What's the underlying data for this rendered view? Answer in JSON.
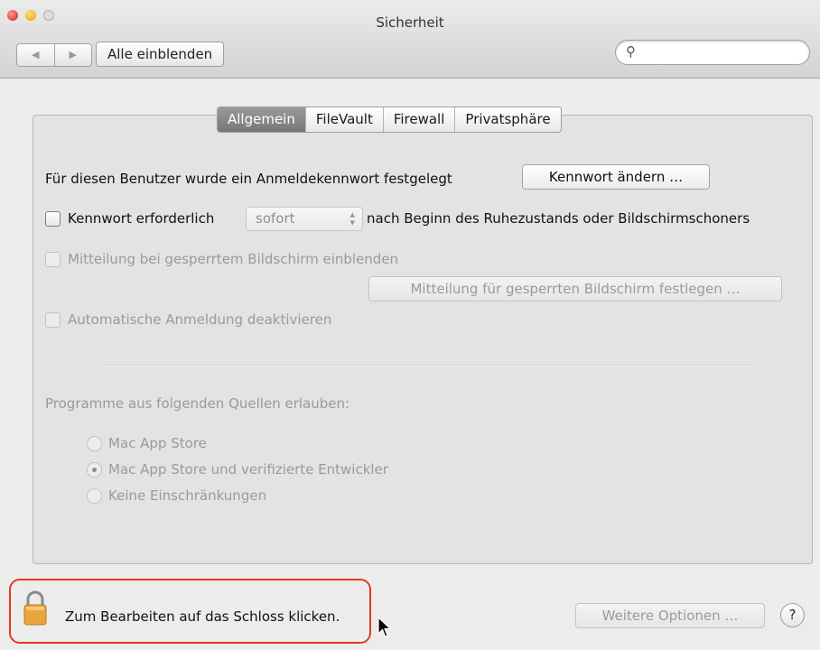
{
  "window": {
    "title": "Sicherheit"
  },
  "toolbar": {
    "back_icon": "back-arrow-icon",
    "forward_icon": "forward-arrow-icon",
    "back_glyph": "◀",
    "forward_glyph": "▶",
    "show_all_label": "Alle einblenden",
    "search_value": "",
    "search_glyph": "⚲"
  },
  "tabs": [
    {
      "label": "Allgemein",
      "active": true
    },
    {
      "label": "FileVault",
      "active": false
    },
    {
      "label": "Firewall",
      "active": false
    },
    {
      "label": "Privatsphäre",
      "active": false
    }
  ],
  "general": {
    "password_set_text": "Für diesen Benutzer wurde ein Anmeldekennwort festgelegt",
    "change_password_label": "Kennwort ändern …",
    "require_password_label": "Kennwort erforderlich",
    "require_password_checked": false,
    "require_password_delay": "sofort",
    "require_password_suffix": "nach Beginn des Ruhezustands oder Bildschirmschoners",
    "show_message_label": "Mitteilung bei gesperrtem Bildschirm einblenden",
    "set_message_label": "Mitteilung für gesperrten Bildschirm festlegen …",
    "disable_autologin_label": "Automatische Anmeldung deaktivieren"
  },
  "gatekeeper": {
    "heading": "Programme aus folgenden Quellen erlauben:",
    "options": [
      {
        "label": "Mac App Store",
        "selected": false
      },
      {
        "label": "Mac App Store und verifizierte Entwickler",
        "selected": true
      },
      {
        "label": "Keine Einschränkungen",
        "selected": false
      }
    ]
  },
  "footer": {
    "lock_text": "Zum Bearbeiten auf das Schloss klicken.",
    "more_options_label": "Weitere Optionen …",
    "help_label": "?"
  },
  "colors": {
    "highlight_border": "#e03a22",
    "lock_body": "#e9a640"
  }
}
